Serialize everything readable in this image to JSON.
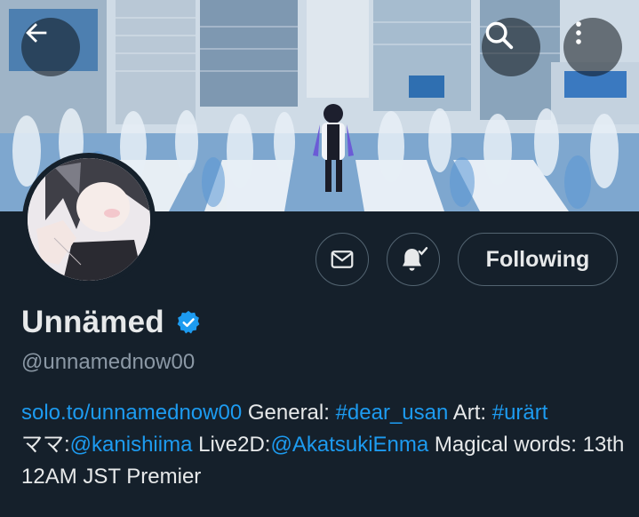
{
  "profile": {
    "display_name": "Unnämed",
    "verified": true,
    "handle": "@unnamednow00",
    "bio": {
      "link": "solo.to/unnamednow00",
      "text1": " General: ",
      "tag_general": "#dear_usan",
      "text2": " Art: ",
      "tag_art": "#urärt",
      "text3": "ママ:",
      "mention_mama": "@kanishiima",
      "text4": " Live2D:",
      "mention_live2d": "@AkatsukiEnma",
      "text5": " Magical words: 13th 12AM JST Premier"
    }
  },
  "actions": {
    "following_label": "Following"
  },
  "colors": {
    "background": "#15202b",
    "accent_link": "#1d9bf0",
    "muted_text": "#8b98a5",
    "border": "#536471"
  },
  "icons": [
    "back-arrow-icon",
    "search-icon",
    "more-vertical-icon",
    "mail-icon",
    "bell-notify-icon",
    "verified-badge-icon"
  ]
}
